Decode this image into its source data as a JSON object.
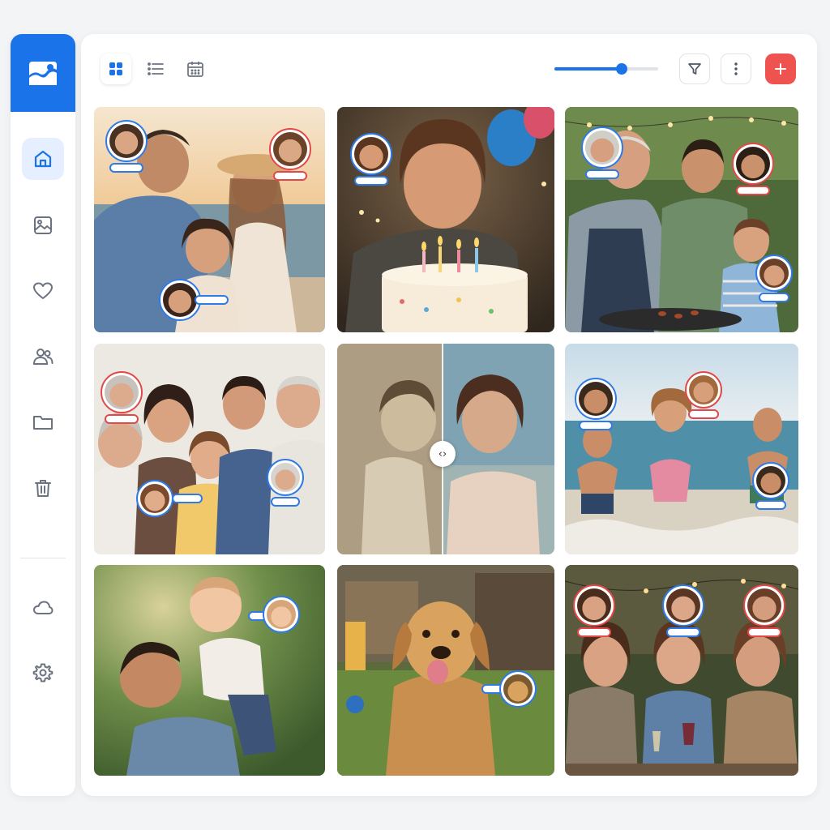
{
  "sidebar": {
    "logo_icon": "photos-logo-icon",
    "accent": "#1a73e8",
    "items": [
      {
        "name": "home",
        "icon": "home-icon",
        "active": true
      },
      {
        "name": "photos",
        "icon": "image-icon",
        "active": false
      },
      {
        "name": "favorites",
        "icon": "heart-icon",
        "active": false
      },
      {
        "name": "people",
        "icon": "people-icon",
        "active": false
      },
      {
        "name": "albums",
        "icon": "folder-icon",
        "active": false
      },
      {
        "name": "trash",
        "icon": "trash-icon",
        "active": false
      },
      {
        "name": "cloud",
        "icon": "cloud-icon",
        "active": false
      },
      {
        "name": "settings",
        "icon": "gear-icon",
        "active": false
      }
    ]
  },
  "toolbar": {
    "view_modes": [
      {
        "icon": "grid-view-icon",
        "active": true
      },
      {
        "icon": "list-view-icon",
        "active": false
      },
      {
        "icon": "calendar-view-icon",
        "active": false
      }
    ],
    "thumbnail_size_level": 0.65,
    "filter_icon": "filter-icon",
    "more_icon": "more-vertical-icon",
    "add_icon": "plus-icon",
    "add_color": "#ef5350"
  },
  "photos": [
    {
      "scene": "family-beach-sunset",
      "face_tags": 3
    },
    {
      "scene": "boy-birthday-cake",
      "face_tags": 1
    },
    {
      "scene": "grandpa-barbecue",
      "face_tags": 3
    },
    {
      "scene": "multi-generation-family",
      "face_tags": 3
    },
    {
      "scene": "old-photo-restoration-compare",
      "face_tags": 0
    },
    {
      "scene": "kids-running-beach",
      "face_tags": 3
    },
    {
      "scene": "dad-lifting-baby",
      "face_tags": 1
    },
    {
      "scene": "golden-retriever-backyard",
      "face_tags": 1
    },
    {
      "scene": "friends-evening-dinner",
      "face_tags": 3
    }
  ],
  "tag_colors": {
    "known": "#2f7ae5",
    "unknown": "#e24848"
  }
}
